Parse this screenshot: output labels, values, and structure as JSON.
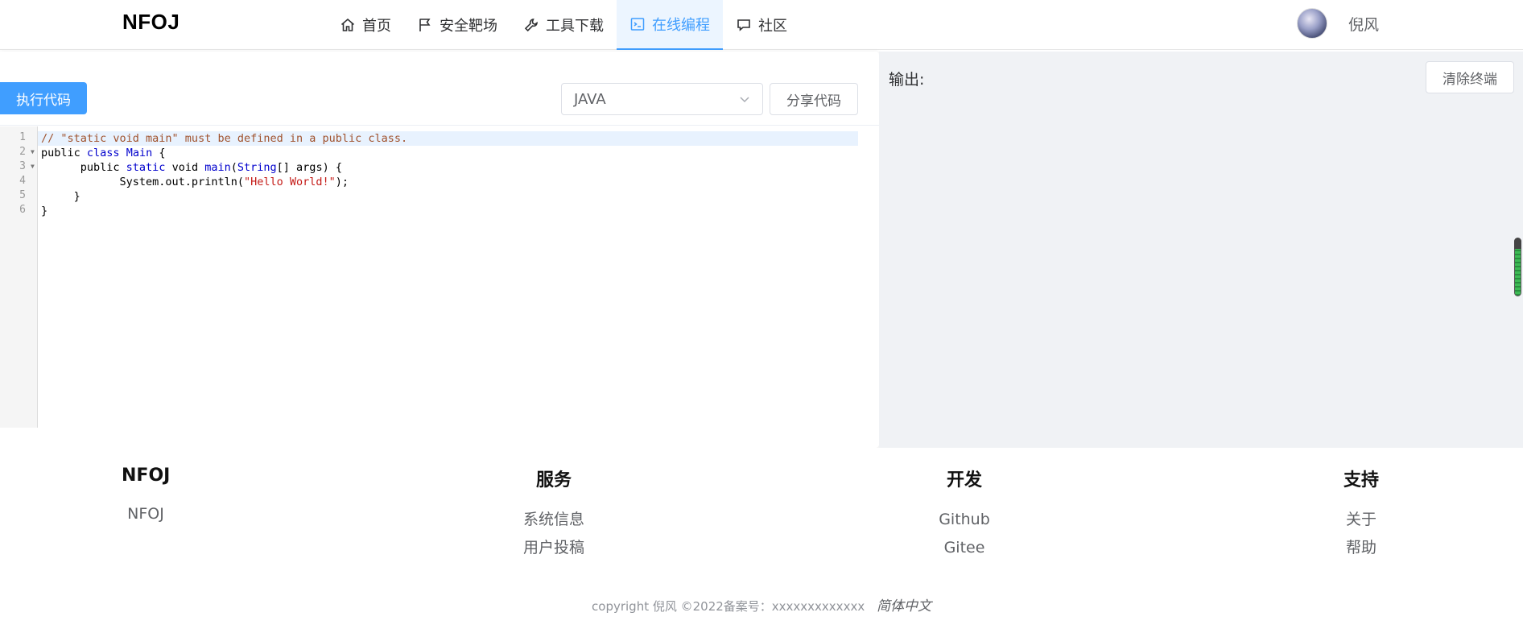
{
  "header": {
    "logo": "NFOJ",
    "nav": [
      {
        "label": "首页",
        "icon": "home-icon"
      },
      {
        "label": "安全靶场",
        "icon": "flag-icon"
      },
      {
        "label": "工具下载",
        "icon": "wrench-icon"
      },
      {
        "label": "在线编程",
        "icon": "terminal-icon",
        "active": true
      },
      {
        "label": "社区",
        "icon": "chat-icon"
      }
    ],
    "username": "倪风"
  },
  "editor": {
    "run_label": "执行代码",
    "language": "JAVA",
    "share_label": "分享代码",
    "line_numbers": [
      "1",
      "2",
      "3",
      "4",
      "5",
      "6"
    ],
    "code_lines": [
      "// \"static void main\" must be defined in a public class.",
      "public class Main {",
      "      public static void main(String[] args) {",
      "            System.out.println(\"Hello World!\");",
      "     }",
      "}"
    ]
  },
  "output": {
    "label": "输出:",
    "clear_label": "清除终端"
  },
  "footer": {
    "columns": [
      {
        "title": "NFOJ",
        "links": [
          "NFOJ"
        ]
      },
      {
        "title": "服务",
        "links": [
          "系统信息",
          "用户投稿"
        ]
      },
      {
        "title": "开发",
        "links": [
          "Github",
          "Gitee"
        ]
      },
      {
        "title": "支持",
        "links": [
          "关于",
          "帮助"
        ]
      }
    ],
    "copyright": "copyright 倪风 ©2022备案号：xxxxxxxxxxxxx",
    "language_switch": "简体中文"
  },
  "colors": {
    "accent": "#409eff",
    "panel_bg": "#f0f2f5"
  }
}
